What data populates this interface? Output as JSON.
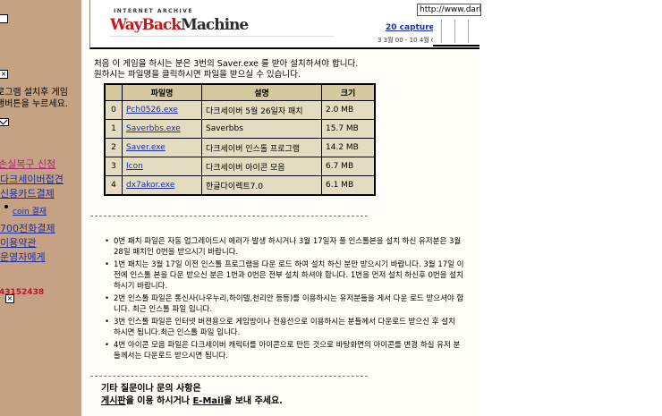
{
  "left_panel": {
    "text_line1": "로그램 설치후 게임",
    "text_line2": "행버튼을 누르세요.",
    "links": [
      {
        "label": "손실복구 신청"
      },
      {
        "label": "다크세이버접견"
      },
      {
        "label": "신용카드결제"
      },
      {
        "label": "coin 결재"
      },
      {
        "label": "700전화결제"
      },
      {
        "label": "이용약관"
      },
      {
        "label": "운영자에게"
      }
    ],
    "counter": "43152438",
    "colors": {
      "background": "#c4a283",
      "link": "#1a2ea8",
      "counter": "#c8102e"
    }
  },
  "wayback": {
    "brand_top": "INTERNET ARCHIVE",
    "brand_logo_a": "WayBack",
    "brand_logo_b": "Machine",
    "captures": "20 captures",
    "date_range": "3 3월 00 - 10 4월 04",
    "url": "http://www.darks"
  },
  "intro": {
    "line1": "처음 이 게임을 하시는 분은 3번의 Saver.exe 를 받아 설치하셔야 합니다.",
    "line2": "원하시는 파일명을 클릭하시면 파일을 받으실 수 있습니다."
  },
  "table": {
    "headers": [
      "",
      "파일명",
      "설명",
      "크기"
    ],
    "rows": [
      {
        "no": "0",
        "file": "Pch0526.exe",
        "desc": "다크세이버 5월 26일자 패치",
        "size": "2.0 MB"
      },
      {
        "no": "1",
        "file": "Saverbbs.exe",
        "desc": "Saverbbs",
        "size": "15.7 MB"
      },
      {
        "no": "2",
        "file": "Saver.exe",
        "desc": "다크세이버 인스톨 프로그램",
        "size": "14.2 MB"
      },
      {
        "no": "3",
        "file": "Icon",
        "desc": "다크세이버 아이콘 모음",
        "size": "6.7 MB"
      },
      {
        "no": "4",
        "file": "dx7akor.exe",
        "desc": "한글다이렉트7.0",
        "size": "6.1 MB"
      }
    ]
  },
  "notes": [
    "0번 패치 파일은 자동 업그레이드시 에러가 발생 하시거나 3월 17일자 풀 인스톨본을 설치 하신 유저분은 3월 28일 패치인 0번을 받으시기 바랍니다.",
    "1번 패치는 3월 17일 이전 인스톨 프로그램을 다운 로드 하여 설치 하신 분만 받으시기 바랍니다. 3월 17일 이전에 인스톨 본을 다운 받으신 분은 1번과 0번은 전부 설치 하셔야 합니다. 1번을 먼저 설치 하신후 0번을 설치 하시기 바랍니다.",
    "2번 인스톨 파일은 통신사(나우누리,하이텔,천리안 등등)를 이용하시는 유저분들을 게서 다운 로드 받으셔야 합니다. 최근 인스톨 파일 입니다.",
    "3번 인스톨 파일은 인터넷 버젼용으로 게임방이나 전용선으로 이용하시는 분들께서 다운로드 받으신 후 설치 하시면 됩니다.최근 인스톨 파일 입니다.",
    "4번 아이콘 모음 파일은 다크세이버 캐릭터를 아이콘으로 만든 것으로 바탕화면의 아이콘를 변경 하실 유저 분들께서는 다운로드 받으시면 됩니다."
  ],
  "contact": {
    "line1": "기타 질문이나 문의 사항은",
    "board_link": "게시판",
    "middle": "을 이용 하시거나 ",
    "email_link": "E-Mail",
    "end": "을 보내 주세요."
  }
}
